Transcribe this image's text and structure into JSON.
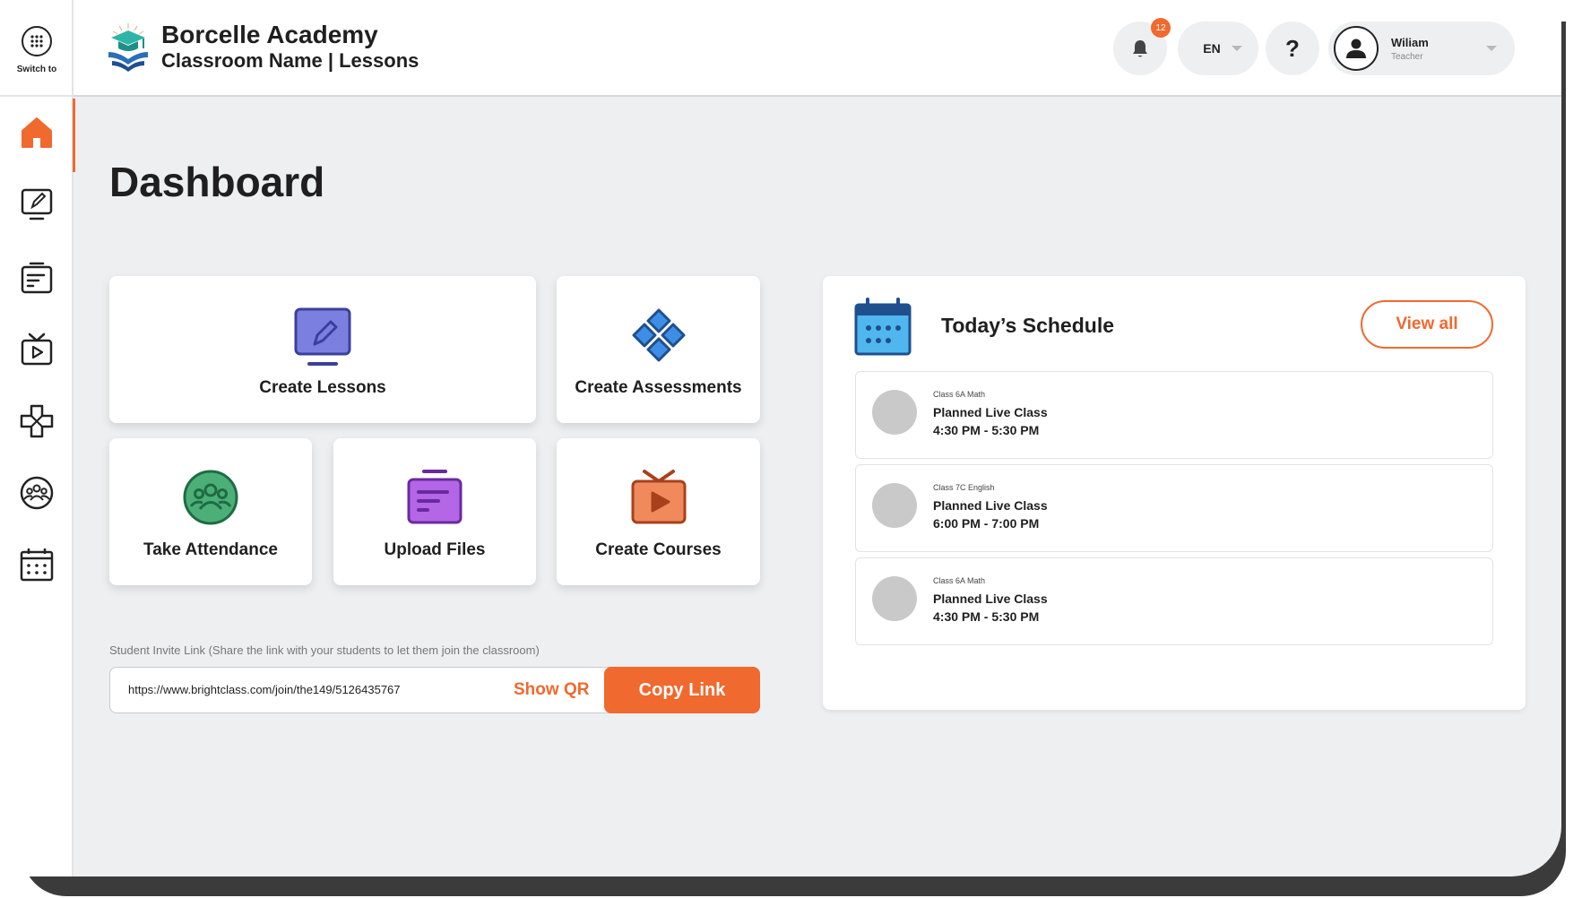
{
  "sidebar": {
    "switch_label": "Switch to",
    "items": [
      {
        "icon": "home-icon",
        "active": true
      },
      {
        "icon": "lesson-monitor-icon"
      },
      {
        "icon": "files-icon"
      },
      {
        "icon": "courses-tv-icon"
      },
      {
        "icon": "assessments-icon"
      },
      {
        "icon": "attendance-icon"
      },
      {
        "icon": "calendar-icon"
      }
    ]
  },
  "header": {
    "brand_name": "Borcelle Academy",
    "subtitle": "Classroom Name | Lessons",
    "notification_count": "12",
    "language": "EN",
    "help_label": "?",
    "user_name": "Wiliam",
    "user_role": "Teacher"
  },
  "main": {
    "title": "Dashboard",
    "cards": {
      "create_lessons": "Create Lessons",
      "create_assessments": "Create Assessments",
      "take_attendance": "Take Attendance",
      "upload_files": "Upload Files",
      "create_courses": "Create Courses"
    },
    "invite": {
      "label": "Student Invite Link (Share the link with your students to let them join the classroom)",
      "url": "https://www.brightclass.com/join/the149/5126435767",
      "show_qr": "Show QR",
      "copy_link": "Copy Link"
    }
  },
  "schedule": {
    "title": "Today’s Schedule",
    "view_all": "View all",
    "items": [
      {
        "class": "Class 6A Math",
        "name": "Planned Live Class",
        "time": "4:30 PM - 5:30 PM"
      },
      {
        "class": "Class 7C English",
        "name": "Planned Live Class",
        "time": "6:00 PM - 7:00 PM"
      },
      {
        "class": "Class 6A Math",
        "name": "Planned Live Class",
        "time": "4:30 PM - 5:30 PM"
      }
    ]
  },
  "colors": {
    "accent": "#f0692e",
    "background": "#eeeff1",
    "lessons_icon": "#7b7fe0",
    "assessments_icon": "#3d8ee6",
    "attendance_icon": "#4caf78",
    "files_icon": "#b366e6",
    "courses_icon": "#f08a5d"
  }
}
